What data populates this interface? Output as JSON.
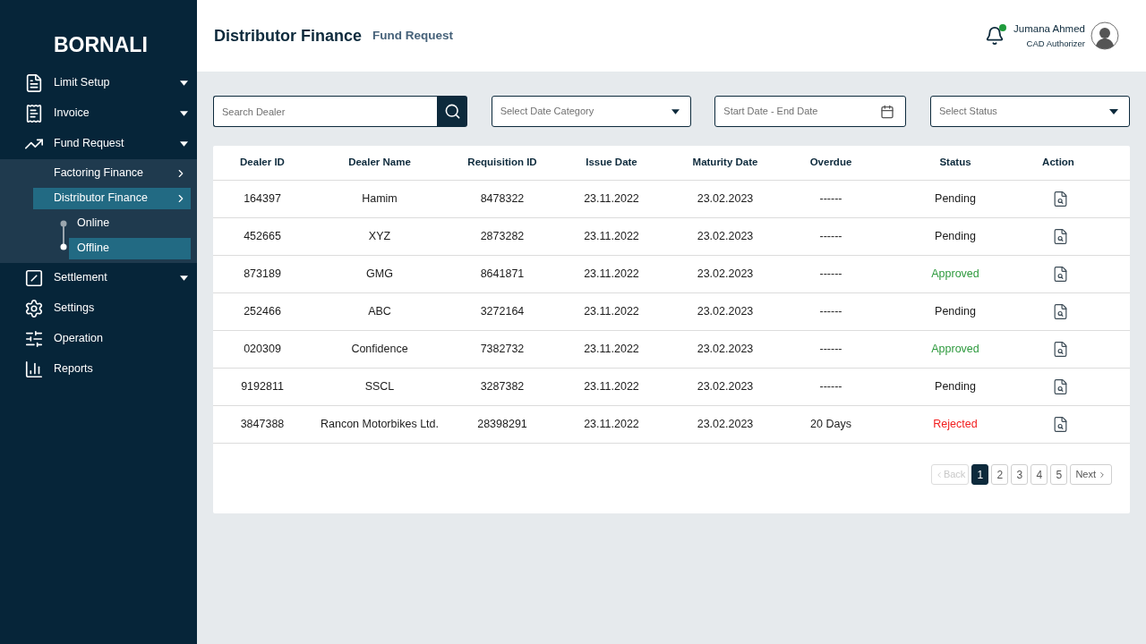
{
  "sidebar": {
    "logo": "BORNALI",
    "items": [
      {
        "label": "Limit Setup",
        "kind": "menu"
      },
      {
        "label": "Invoice",
        "kind": "menu"
      },
      {
        "label": "Fund Request",
        "kind": "menu",
        "children": [
          {
            "label": "Factoring Finance",
            "selected": false
          },
          {
            "label": "Distributor Finance",
            "selected": true,
            "children": [
              {
                "label": "Online",
                "selected": false
              },
              {
                "label": "Offline",
                "selected": true
              }
            ]
          }
        ]
      },
      {
        "label": "Settlement",
        "kind": "menu"
      },
      {
        "label": "Settings",
        "kind": "link"
      },
      {
        "label": "Operation",
        "kind": "link"
      },
      {
        "label": "Reports",
        "kind": "link"
      }
    ]
  },
  "header": {
    "title": "Distributor Finance",
    "subtitle": "Fund Request",
    "notification": true,
    "user": {
      "name": "Jumana Ahmed",
      "role": "CAD Authorizer"
    }
  },
  "filters": {
    "search": {
      "placeholder": "Search Dealer"
    },
    "date_category": {
      "placeholder": "Select Date Category"
    },
    "date_range": {
      "placeholder": "Start Date - End Date"
    },
    "status": {
      "placeholder": "Select Status"
    }
  },
  "table": {
    "columns": [
      "Dealer ID",
      "Dealer Name",
      "Requisition ID",
      "Issue Date",
      "Maturity Date",
      "Overdue",
      "Status",
      "Action"
    ],
    "rows": [
      {
        "dealer_id": "164397",
        "dealer_name": "Hamim",
        "requisition_id": "8478322",
        "issue_date": "23.11.2022",
        "maturity_date": "23.02.2023",
        "overdue": "------",
        "status": "Pending",
        "kind": "pending"
      },
      {
        "dealer_id": "452665",
        "dealer_name": "XYZ",
        "requisition_id": "2873282",
        "issue_date": "23.11.2022",
        "maturity_date": "23.02.2023",
        "overdue": "------",
        "status": "Pending",
        "kind": "pending"
      },
      {
        "dealer_id": "873189",
        "dealer_name": "GMG",
        "requisition_id": "8641871",
        "issue_date": "23.11.2022",
        "maturity_date": "23.02.2023",
        "overdue": "------",
        "status": "Approved",
        "kind": "approved"
      },
      {
        "dealer_id": "252466",
        "dealer_name": "ABC",
        "requisition_id": "3272164",
        "issue_date": "23.11.2022",
        "maturity_date": "23.02.2023",
        "overdue": "------",
        "status": "Pending",
        "kind": "pending"
      },
      {
        "dealer_id": "020309",
        "dealer_name": "Confidence",
        "requisition_id": "7382732",
        "issue_date": "23.11.2022",
        "maturity_date": "23.02.2023",
        "overdue": "------",
        "status": "Approved",
        "kind": "approved"
      },
      {
        "dealer_id": "9192811",
        "dealer_name": "SSCL",
        "requisition_id": "3287382",
        "issue_date": "23.11.2022",
        "maturity_date": "23.02.2023",
        "overdue": "------",
        "status": "Pending",
        "kind": "pending"
      },
      {
        "dealer_id": "3847388",
        "dealer_name": "Rancon Motorbikes Ltd.",
        "requisition_id": "28398291",
        "issue_date": "23.11.2022",
        "maturity_date": "23.02.2023",
        "overdue": "20 Days",
        "status": "Rejected",
        "kind": "rejected"
      }
    ]
  },
  "pagination": {
    "back": {
      "label": "Back",
      "disabled": true
    },
    "pages": [
      {
        "label": "1",
        "selected": true
      },
      {
        "label": "2",
        "selected": false
      },
      {
        "label": "3",
        "selected": false
      },
      {
        "label": "4",
        "selected": false
      },
      {
        "label": "5",
        "selected": false
      }
    ],
    "next": {
      "label": "Next",
      "disabled": false
    }
  }
}
